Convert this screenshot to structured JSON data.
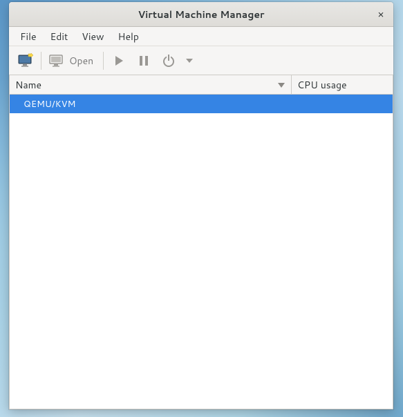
{
  "window": {
    "title": "Virtual Machine Manager",
    "close_glyph": "×"
  },
  "menubar": {
    "file": "File",
    "edit": "Edit",
    "view": "View",
    "help": "Help"
  },
  "toolbar": {
    "open_label": "Open"
  },
  "columns": {
    "name": "Name",
    "cpu": "CPU usage"
  },
  "rows": {
    "0": {
      "label": "QEMU/KVM"
    }
  }
}
